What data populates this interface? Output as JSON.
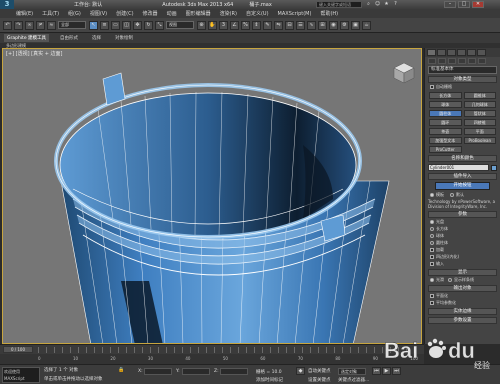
{
  "titlebar": {
    "logo": "3",
    "workspace": "工作台: 默认",
    "app_title": "Autodesk 3ds Max 2013 x64",
    "file_name": "桶子.max",
    "search_placeholder": "键入关键字或短语",
    "minimize": "–",
    "maximize": "□",
    "close": "✕"
  },
  "menubar": {
    "items": [
      "编辑(E)",
      "工具(T)",
      "组(G)",
      "视图(V)",
      "创建(C)",
      "修改器",
      "动画",
      "图形编辑器",
      "渲染(R)",
      "自定义(U)",
      "MAXScript(M)",
      "帮助(H)"
    ]
  },
  "toolbar": {
    "select_filter": "全部",
    "view_dropdown": "视图"
  },
  "ribbon": {
    "tabs": [
      "Graphite 建模工具",
      "自由形式",
      "选择",
      "对象绘制"
    ],
    "sub_label": "多边形建模"
  },
  "viewport": {
    "label": "[+] [透视] [真实 + 边面]"
  },
  "command_panel": {
    "category_dropdown": "标准基本体",
    "object_type_header": "对象类型",
    "autogrid_label": "自动栅格",
    "object_buttons": [
      "长方体",
      "圆锥体",
      "球体",
      "几何球体",
      "圆柱体",
      "管状体",
      "圆环",
      "四棱锥",
      "茶壶",
      "平面",
      "加强型文本",
      "ProBoolean",
      "ProCutter"
    ],
    "name_color_header": "名称和颜色",
    "object_name": "Cylinder001",
    "plugin_header": "插件导入",
    "plugin_button": "开始按钮",
    "radio_options": [
      "模板",
      "默认"
    ],
    "credit_text": "Technology by nPowerSoftware, a Division of IntegrityWare, Inc.",
    "params_header": "参数",
    "params_rows": [
      "光盘",
      "长方体",
      "球体",
      "圆柱体",
      "加载",
      "四边形(内化)",
      "输入"
    ],
    "display_header": "显示",
    "display_options": [
      "光滑",
      "显示样条线"
    ],
    "output_header": "输出对象",
    "output_options": [
      "平面化",
      "平均参数化"
    ],
    "sub_header": "实体边缘",
    "misc_header": "参数设置"
  },
  "timeline": {
    "slider": "0 / 100",
    "tick_labels": [
      "0",
      "10",
      "20",
      "30",
      "40",
      "50",
      "60",
      "70",
      "80",
      "90",
      "100"
    ]
  },
  "statusbar": {
    "listener_lines": [
      "欢迎使用",
      "MAXScript"
    ],
    "selection_info": "选择了 1 个 对象",
    "prompt_info": "单击或单击并拖动以选择对象",
    "x_value": "X:",
    "y_value": "Y:",
    "z_value": "Z:",
    "grid_info": "栅格 = 10.0",
    "autokey": "自动关键点",
    "setkey": "设置关键点",
    "selected_label": "选定对象",
    "add_time_tag": "添加时间标记",
    "filters": "关键点过滤器..."
  },
  "colors": {
    "bucket_fill": "#3e7ec0",
    "bucket_rim": "#9ccaf0",
    "bucket_shadow": "#142a40",
    "wire": "#ffffff",
    "viewport_bg": "#767676",
    "viewport_border": "#c7a53f",
    "accent_button": "#4a78b8"
  },
  "watermark": {
    "text": "Bai",
    "logo": "du",
    "sub": "经验"
  }
}
